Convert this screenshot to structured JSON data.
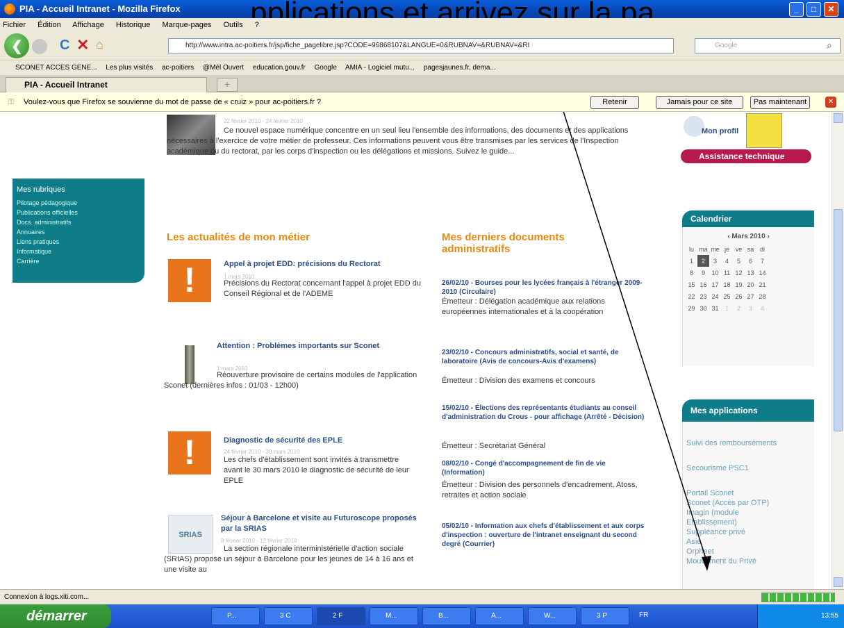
{
  "caption": "pplications et arrivez sur la pa",
  "window": {
    "title": "PIA - Accueil Intranet - Mozilla Firefox"
  },
  "menu": [
    "Fichier",
    "Édition",
    "Affichage",
    "Historique",
    "Marque-pages",
    "Outils",
    "?"
  ],
  "nav": {
    "url": "http://www.intra.ac-poitiers.fr/jsp/fiche_pagelibre.jsp?CODE=96868107&LANGUE=0&RUBNAV=&RUBNAV=&RI",
    "search_placeholder": "Google"
  },
  "bookmarks": [
    "SCONET ACCES GENE...",
    "Les plus visités",
    "ac-poitiers",
    "@Mél Ouvert",
    "education.gouv.fr",
    "Google",
    "AMIA - Logiciel mutu...",
    "pagesjaunes.fr, dema..."
  ],
  "tab": {
    "label": "PIA - Accueil Intranet"
  },
  "notification": {
    "text": "Voulez-vous que Firefox se souvienne du mot de passe de « cruiz » pour ac-poitiers.fr ?",
    "btn_remember": "Retenir",
    "btn_never": "Jamais pour ce site",
    "btn_not_now": "Pas maintenant"
  },
  "sidebar": {
    "title": "Mes rubriques",
    "items": [
      "Pilotage pédagogique",
      "Publications officielles",
      "Docs. administratifs",
      "Annuaires",
      "Liens pratiques",
      "Informatique",
      "Carrière"
    ]
  },
  "intro": {
    "date": "22 février 2010 - 24 février 2010",
    "text": "Ce nouvel espace numérique concentre en un seul lieu l'ensemble des informations, des documents et des applications nécessaires à l'exercice de votre métier de professeur. Ces informations peuvent vous être transmises par les services de l'Inspection académique ou du rectorat, par les corps d'inspection ou les délégations et missions. Suivez le guide..."
  },
  "news": {
    "heading": "Les actualités de mon métier",
    "items": [
      {
        "title": "Appel à projet EDD: précisions du Rectorat",
        "date": "1 mars 2010",
        "text": "Précisions du Rectorat concernant l'appel à projet EDD du Conseil Régional et de l'ADEME"
      },
      {
        "title": "Attention : Problèmes importants sur Sconet",
        "date": "1 mars 2010",
        "text": "Réouverture provisoire de certains modules de l'application Sconet (dernières infos : 01/03 - 12h00)"
      },
      {
        "title": "Diagnostic de sécurité des EPLE",
        "date": "24 février 2010 - 30 mars 2010",
        "text": "Les chefs d'établissement sont invités à transmettre avant le 30 mars 2010 le diagnostic de sécurité de leur EPLE"
      },
      {
        "title": "Séjour à Barcelone et visite au Futuroscope proposés par la SRIAS",
        "date": "8 février 2010 - 12 février 2010",
        "text": "La section régionale interministérielle d'action sociale (SRIAS) propose un séjour à Barcelone pour les jeunes de 14 à 16 ans et une visite au"
      }
    ]
  },
  "docs": {
    "heading": "Mes derniers documents administratifs",
    "items": [
      {
        "title": "26/02/10 - Bourses pour les lycées français à l'étranger 2009-2010 (Circulaire)",
        "sender": "Émetteur : Délégation académique aux relations européennes internationales et à la coopération"
      },
      {
        "title": "23/02/10 - Concours administratifs, social et santé, de laboratoire (Avis de concours-Avis d'examens)",
        "sender": "Émetteur : Division des examens et concours"
      },
      {
        "title": "15/02/10 - Élections des représentants étudiants au conseil d'administration du Crous - pour affichage (Arrêté - Décision)",
        "sender": "Émetteur : Secrétariat Général"
      },
      {
        "title": "08/02/10 - Congé d'accompagnement de fin de vie (Information)",
        "sender": "Émetteur : Division des personnels d'encadrement, Atoss, retraites et action sociale"
      },
      {
        "title": "05/02/10 - Information aux chefs d'établissement et aux corps d'inspection : ouverture de l'intranet enseignant du second degré (Courrier)",
        "sender": ""
      }
    ]
  },
  "profile": {
    "link": "Mon profil",
    "assist": "Assistance technique"
  },
  "calendar": {
    "title": "Calendrier",
    "month": "Mars 2010",
    "days": [
      "lu",
      "ma",
      "me",
      "je",
      "ve",
      "sa",
      "di"
    ],
    "weeks": [
      [
        "1",
        "2",
        "3",
        "4",
        "5",
        "6",
        "7"
      ],
      [
        "8",
        "9",
        "10",
        "11",
        "12",
        "13",
        "14"
      ],
      [
        "15",
        "16",
        "17",
        "18",
        "19",
        "20",
        "21"
      ],
      [
        "22",
        "23",
        "24",
        "25",
        "26",
        "27",
        "28"
      ],
      [
        "29",
        "30",
        "31",
        "1",
        "2",
        "3",
        "4"
      ]
    ]
  },
  "apps": {
    "title": "Mes applications",
    "items": [
      "Suivi des remboursements",
      "Secourisme PSC1",
      "Portail Sconet",
      "Sconet (Accès par OTP)",
      "Imagin (module Etablissement)",
      "Suppléance privé",
      "Asie",
      "Orpheet",
      "Mouvement du Privé"
    ]
  },
  "status": {
    "text": "Connexion à logs.xiti.com..."
  },
  "taskbar": {
    "start": "démarrer",
    "items": [
      "P...",
      "3 C",
      "2 F",
      "M...",
      "B...",
      "A...",
      "W...",
      "3 P"
    ],
    "lang": "FR",
    "clock": "13:55"
  }
}
